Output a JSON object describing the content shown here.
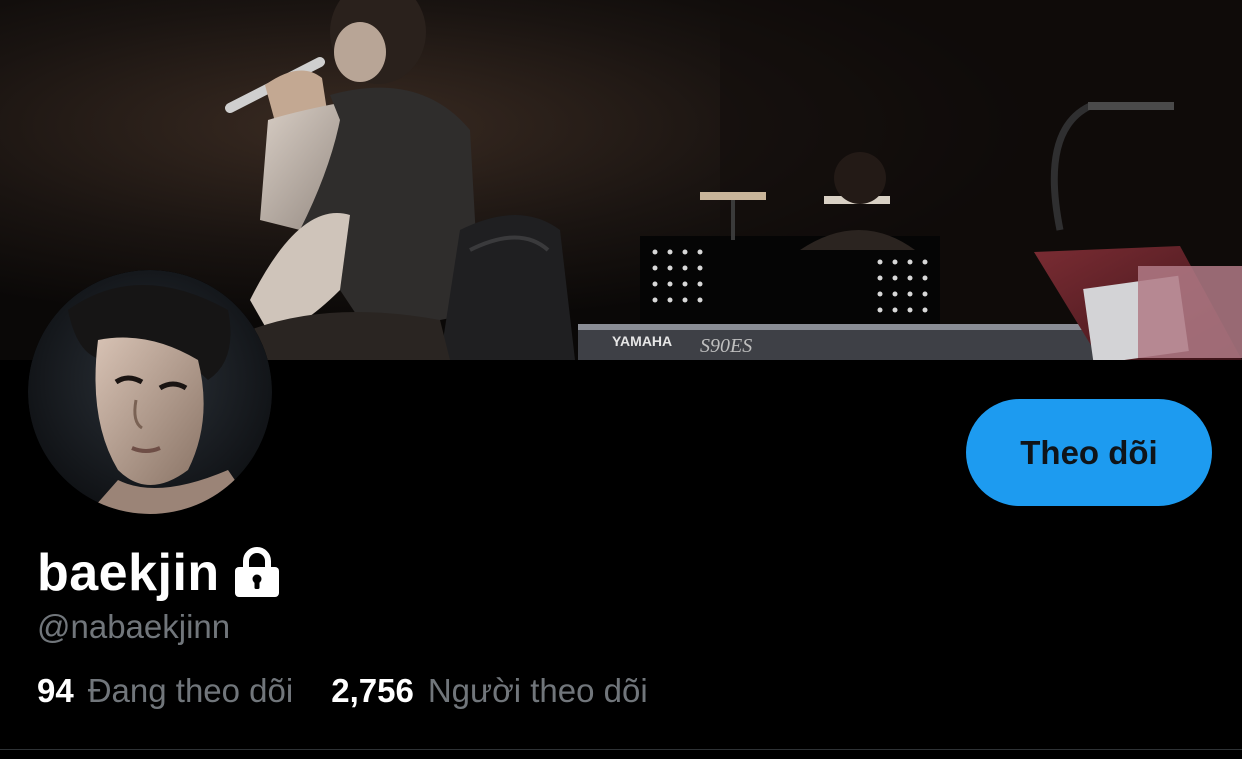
{
  "profile": {
    "display_name": "baekjin",
    "handle": "@nabaekjinn",
    "protected_icon": "lock-icon",
    "follow_button_label": "Theo dõi",
    "following_count": "94",
    "following_label": "Đang theo dõi",
    "followers_count": "2,756",
    "followers_label": "Người theo dõi"
  },
  "banner": {
    "keyboard_brand": "YAMAHA",
    "keyboard_model": "S90ES"
  },
  "colors": {
    "accent": "#1d9bf0",
    "background": "#000000",
    "secondary_text": "#71767b",
    "primary_text": "#ffffff"
  }
}
